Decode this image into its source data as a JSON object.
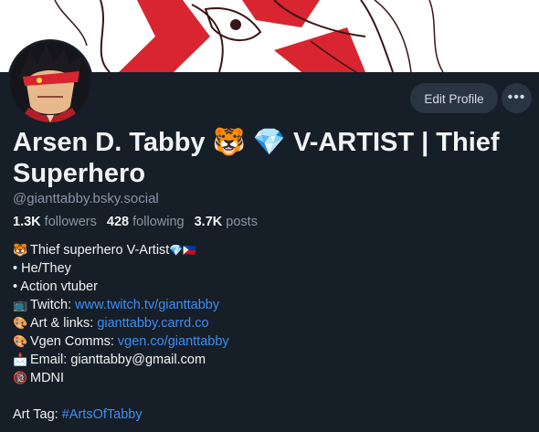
{
  "profile": {
    "display_name": "Arsen D. Tabby",
    "name_emoji_1": "🐯",
    "name_emoji_2": "💎",
    "display_name_rest": "V-ARTIST | Thief Superhero",
    "handle": "@gianttabby.bsky.social",
    "avatar_icon": "avatar-illustration",
    "banner_icon": "banner-artwork"
  },
  "actions": {
    "edit_profile_label": "Edit Profile",
    "more_label": "•••"
  },
  "stats": {
    "followers_count": "1.3K",
    "followers_label": "followers",
    "following_count": "428",
    "following_label": "following",
    "posts_count": "3.7K",
    "posts_label": "posts"
  },
  "bio": {
    "line1_icon": "🐯",
    "line1_text": "Thief superhero V-Artist",
    "line1_icons": "💎🇵🇭",
    "line2": "• He/They",
    "line3": "• Action vtuber",
    "twitch_icon": "📺",
    "twitch_label": "Twitch:",
    "twitch_link": "www.twitch.tv/gianttabby",
    "art_icon": "🎨",
    "art_label": "Art & links:",
    "art_link": "gianttabby.carrd.co",
    "vgen_icon": "🎨",
    "vgen_label": "Vgen Comms:",
    "vgen_link": "vgen.co/gianttabby",
    "email_icon": "📩",
    "email_label": "Email:",
    "email_value": "gianttabby@gmail.com",
    "mdni_icon": "🔞",
    "mdni_text": "MDNI",
    "art_tag_label": "Art Tag:",
    "art_tag_link": "#ArtsOfTabby"
  },
  "colors": {
    "background": "#161e27",
    "button": "#2a3544",
    "link": "#3e8ff5",
    "muted_text": "#8a96a6",
    "banner_accent": "#d8252f"
  }
}
